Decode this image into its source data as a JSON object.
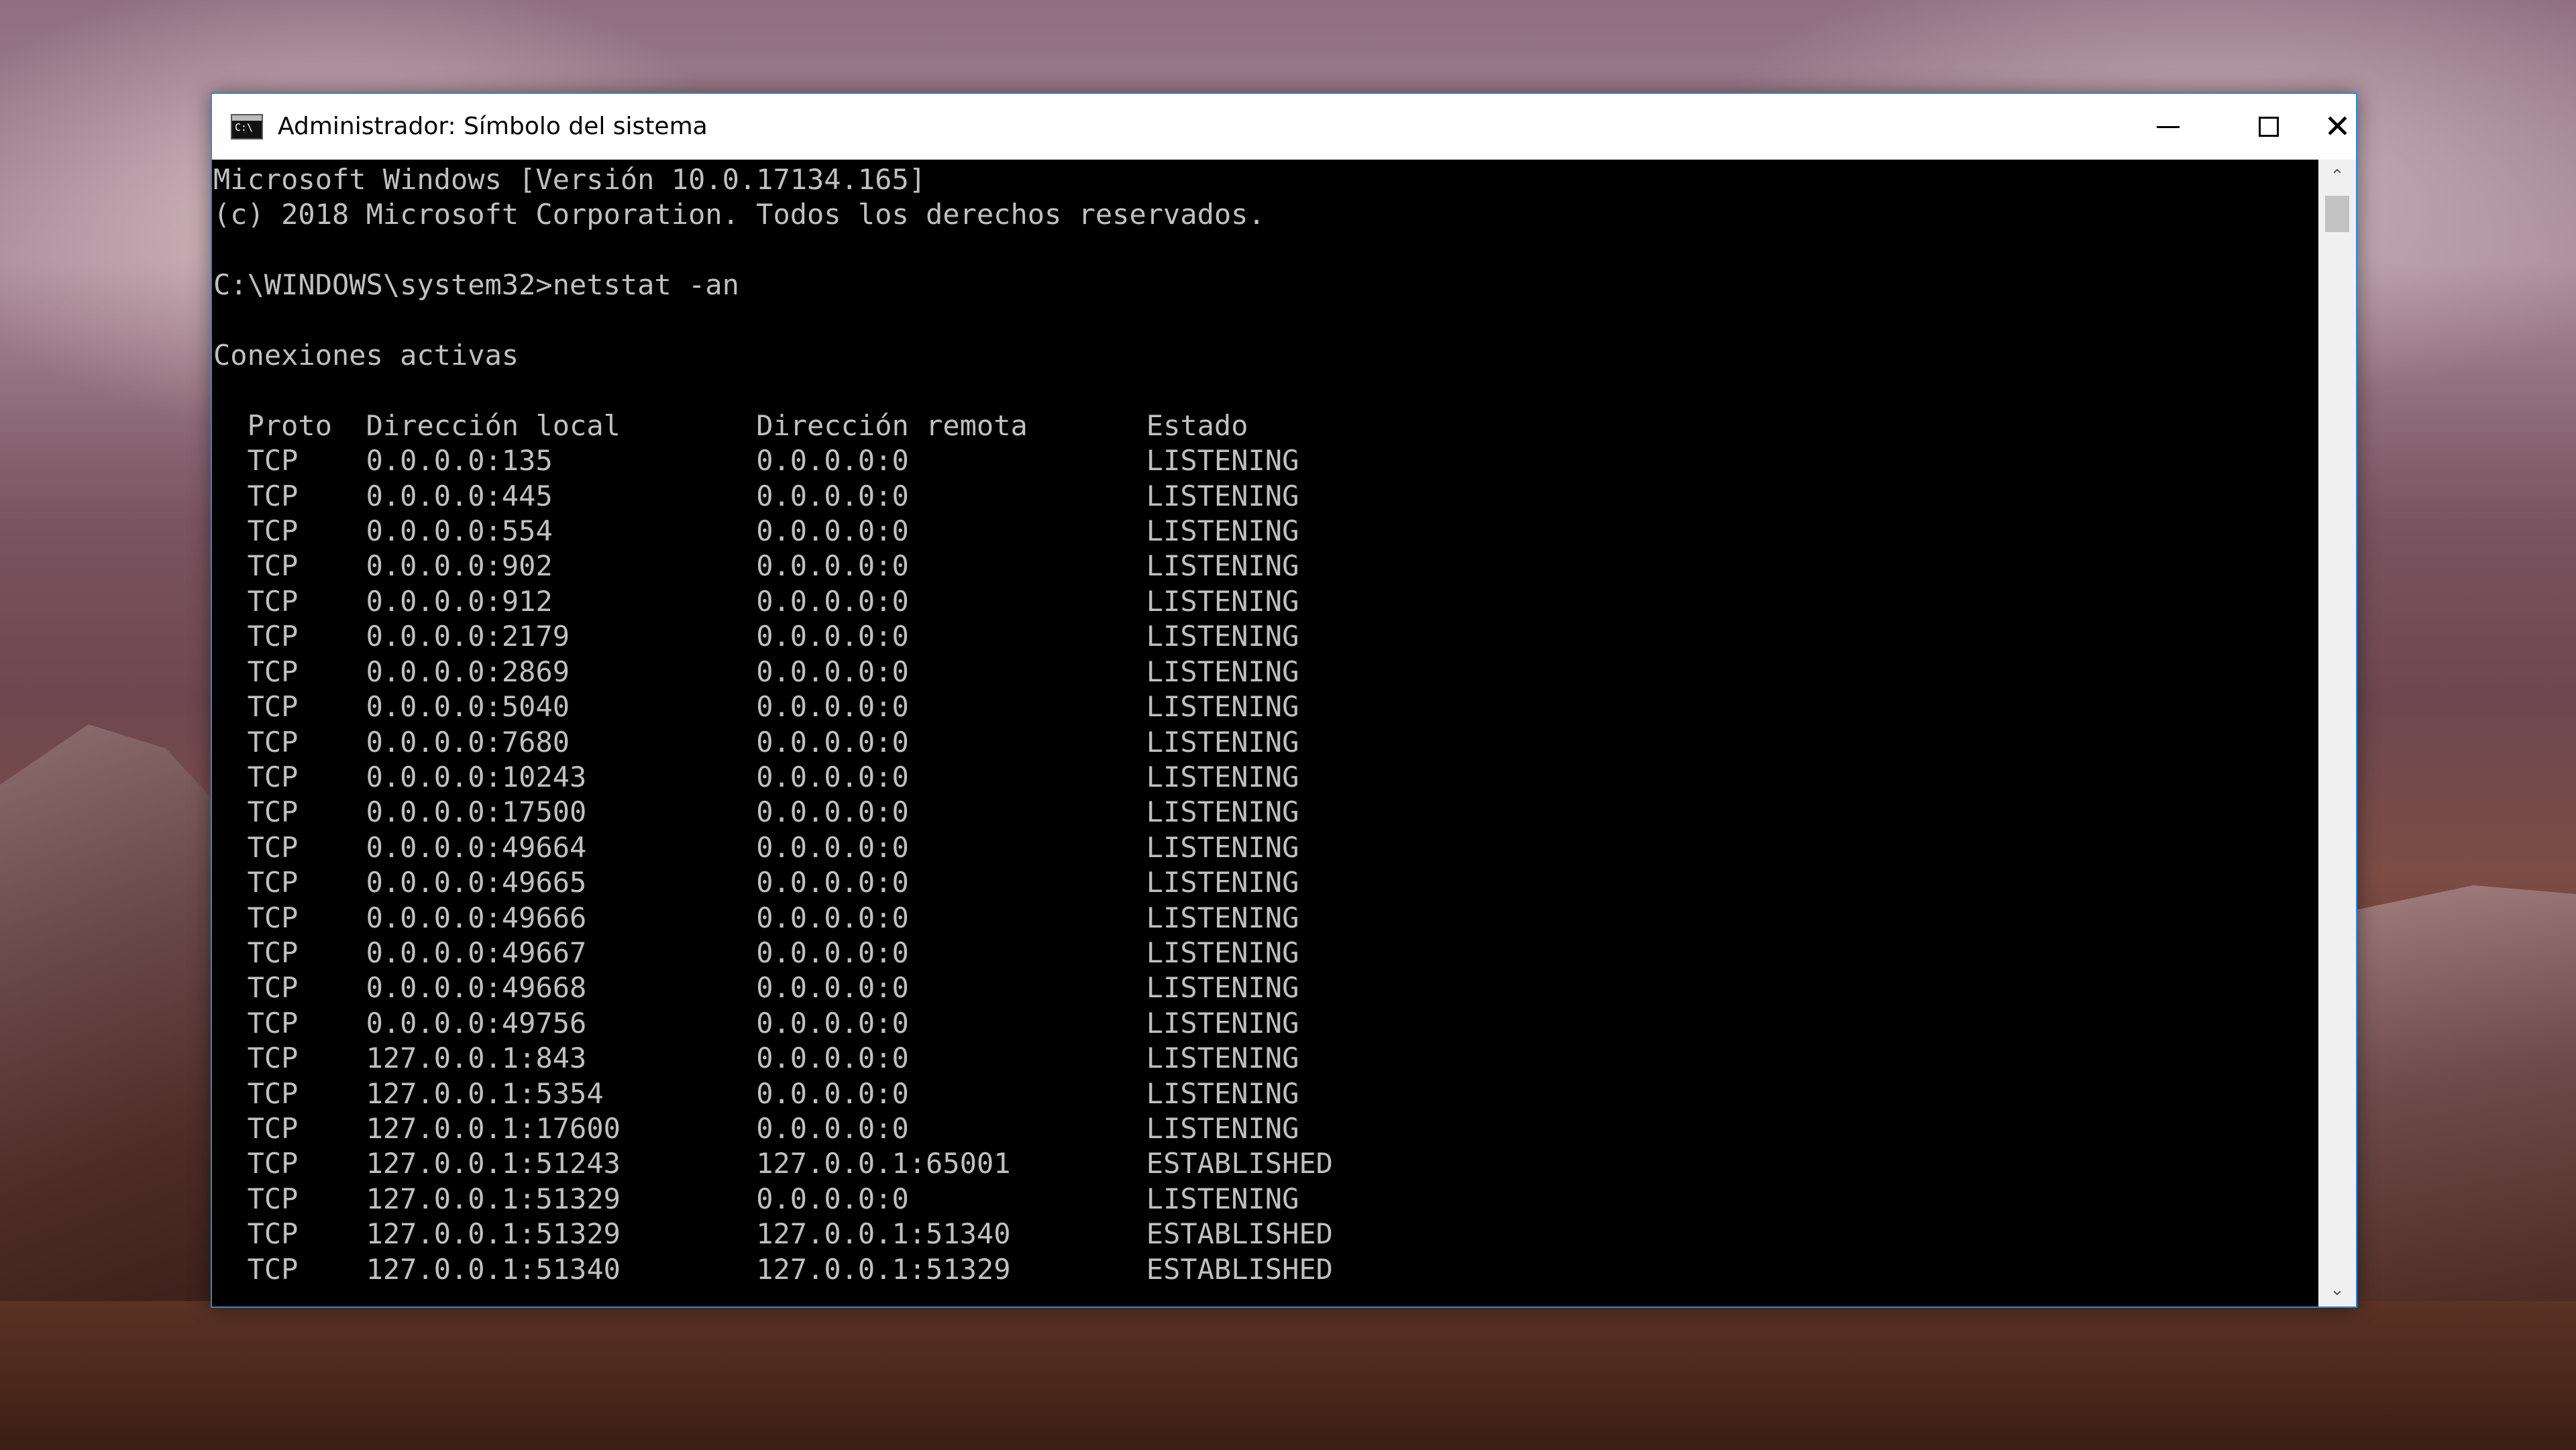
{
  "window": {
    "title": "Administrador: Símbolo del sistema",
    "icon": "cmd-icon",
    "controls": {
      "minimize": "minimize-icon",
      "maximize": "maximize-icon",
      "close": "close-icon",
      "close_glyph": "✕"
    }
  },
  "scrollbar": {
    "up_glyph": "⌃",
    "down_glyph": "⌄"
  },
  "console": {
    "header_lines": [
      "Microsoft Windows [Versión 10.0.17134.165]",
      "(c) 2018 Microsoft Corporation. Todos los derechos reservados."
    ],
    "prompt": "C:\\WINDOWS\\system32>",
    "command": "netstat -an",
    "section_title": "Conexiones activas",
    "columns": [
      "Proto",
      "Dirección local",
      "Dirección remota",
      "Estado"
    ],
    "rows": [
      [
        "TCP",
        "0.0.0.0:135",
        "0.0.0.0:0",
        "LISTENING"
      ],
      [
        "TCP",
        "0.0.0.0:445",
        "0.0.0.0:0",
        "LISTENING"
      ],
      [
        "TCP",
        "0.0.0.0:554",
        "0.0.0.0:0",
        "LISTENING"
      ],
      [
        "TCP",
        "0.0.0.0:902",
        "0.0.0.0:0",
        "LISTENING"
      ],
      [
        "TCP",
        "0.0.0.0:912",
        "0.0.0.0:0",
        "LISTENING"
      ],
      [
        "TCP",
        "0.0.0.0:2179",
        "0.0.0.0:0",
        "LISTENING"
      ],
      [
        "TCP",
        "0.0.0.0:2869",
        "0.0.0.0:0",
        "LISTENING"
      ],
      [
        "TCP",
        "0.0.0.0:5040",
        "0.0.0.0:0",
        "LISTENING"
      ],
      [
        "TCP",
        "0.0.0.0:7680",
        "0.0.0.0:0",
        "LISTENING"
      ],
      [
        "TCP",
        "0.0.0.0:10243",
        "0.0.0.0:0",
        "LISTENING"
      ],
      [
        "TCP",
        "0.0.0.0:17500",
        "0.0.0.0:0",
        "LISTENING"
      ],
      [
        "TCP",
        "0.0.0.0:49664",
        "0.0.0.0:0",
        "LISTENING"
      ],
      [
        "TCP",
        "0.0.0.0:49665",
        "0.0.0.0:0",
        "LISTENING"
      ],
      [
        "TCP",
        "0.0.0.0:49666",
        "0.0.0.0:0",
        "LISTENING"
      ],
      [
        "TCP",
        "0.0.0.0:49667",
        "0.0.0.0:0",
        "LISTENING"
      ],
      [
        "TCP",
        "0.0.0.0:49668",
        "0.0.0.0:0",
        "LISTENING"
      ],
      [
        "TCP",
        "0.0.0.0:49756",
        "0.0.0.0:0",
        "LISTENING"
      ],
      [
        "TCP",
        "127.0.0.1:843",
        "0.0.0.0:0",
        "LISTENING"
      ],
      [
        "TCP",
        "127.0.0.1:5354",
        "0.0.0.0:0",
        "LISTENING"
      ],
      [
        "TCP",
        "127.0.0.1:17600",
        "0.0.0.0:0",
        "LISTENING"
      ],
      [
        "TCP",
        "127.0.0.1:51243",
        "127.0.0.1:65001",
        "ESTABLISHED"
      ],
      [
        "TCP",
        "127.0.0.1:51329",
        "0.0.0.0:0",
        "LISTENING"
      ],
      [
        "TCP",
        "127.0.0.1:51329",
        "127.0.0.1:51340",
        "ESTABLISHED"
      ],
      [
        "TCP",
        "127.0.0.1:51340",
        "127.0.0.1:51329",
        "ESTABLISHED"
      ]
    ]
  },
  "colors": {
    "console_bg": "#000000",
    "console_text": "#c0c0c0",
    "window_border": "#2b8ad8"
  }
}
